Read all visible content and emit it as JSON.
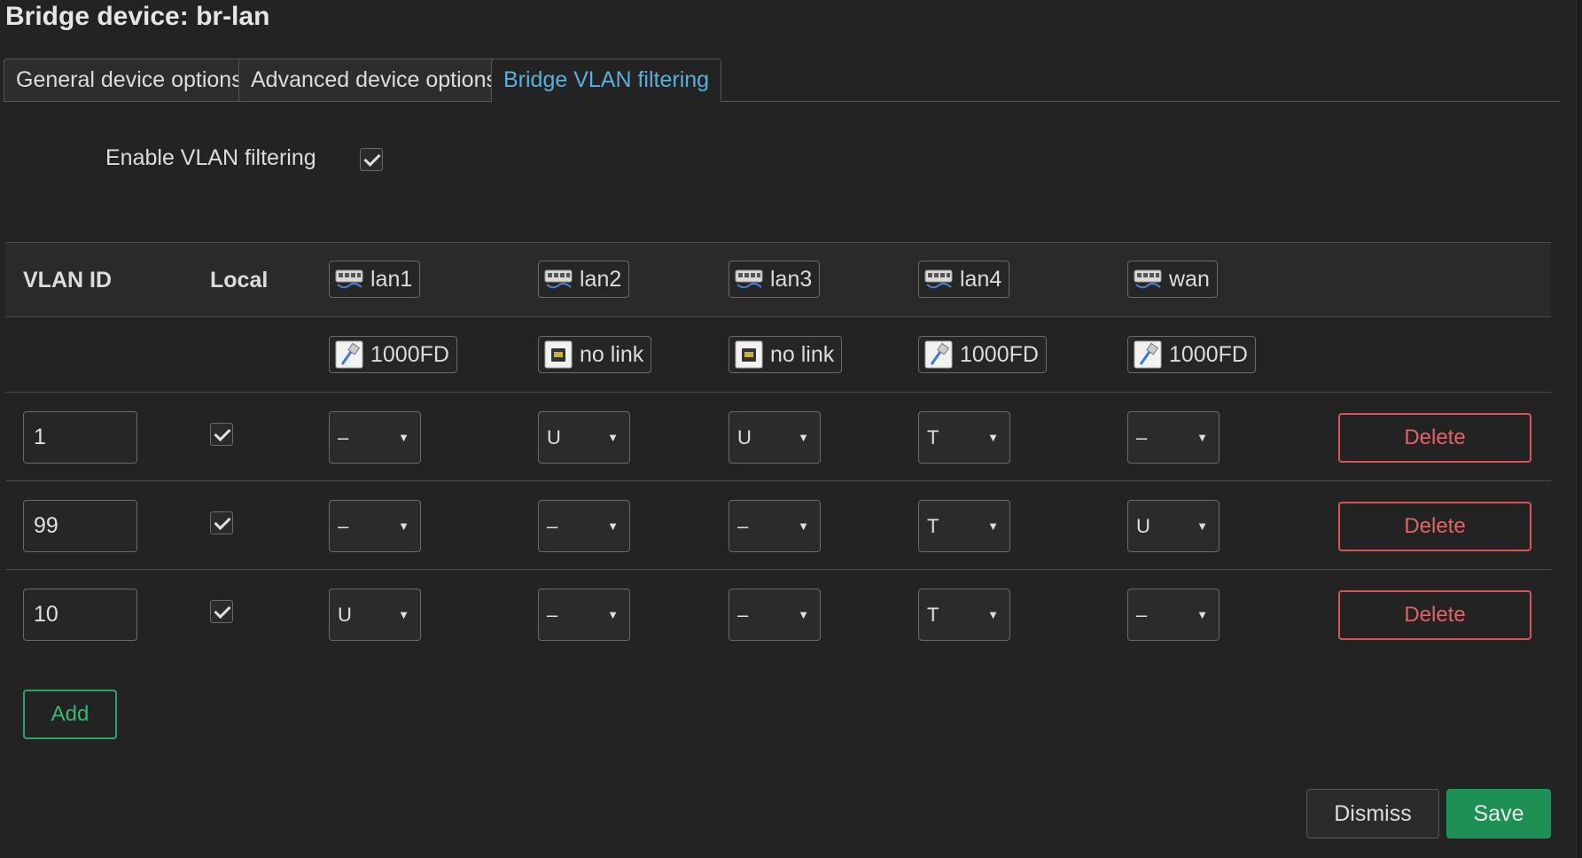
{
  "dialog": {
    "title": "Bridge device: br-lan"
  },
  "tabs": [
    {
      "label": "General device options",
      "active": false
    },
    {
      "label": "Advanced device options",
      "active": false
    },
    {
      "label": "Bridge VLAN filtering",
      "active": true
    }
  ],
  "vlan_filtering": {
    "label": "Enable VLAN filtering",
    "checked": true
  },
  "table": {
    "headers": {
      "vlan_id": "VLAN ID",
      "local": "Local"
    },
    "ports": [
      {
        "name": "lan1",
        "link_status": "1000FD",
        "link_up": true
      },
      {
        "name": "lan2",
        "link_status": "no link",
        "link_up": false
      },
      {
        "name": "lan3",
        "link_status": "no link",
        "link_up": false
      },
      {
        "name": "lan4",
        "link_status": "1000FD",
        "link_up": true
      },
      {
        "name": "wan",
        "link_status": "1000FD",
        "link_up": true
      }
    ],
    "rows": [
      {
        "vlan_id": "1",
        "local": true,
        "ports": [
          "–",
          "U",
          "U",
          "T",
          "–"
        ],
        "delete_label": "Delete"
      },
      {
        "vlan_id": "99",
        "local": true,
        "ports": [
          "–",
          "–",
          "–",
          "T",
          "U"
        ],
        "delete_label": "Delete"
      },
      {
        "vlan_id": "10",
        "local": true,
        "ports": [
          "U",
          "–",
          "–",
          "T",
          "–"
        ],
        "delete_label": "Delete"
      }
    ]
  },
  "buttons": {
    "add": "Add",
    "dismiss": "Dismiss",
    "save": "Save"
  },
  "colors": {
    "accent": "#5ab0db",
    "danger": "#e0646a",
    "success": "#1e8f55"
  },
  "icons": {
    "port": "ethernet-port-icon",
    "link_up": "cable-connected-icon",
    "link_down": "port-no-link-icon"
  }
}
